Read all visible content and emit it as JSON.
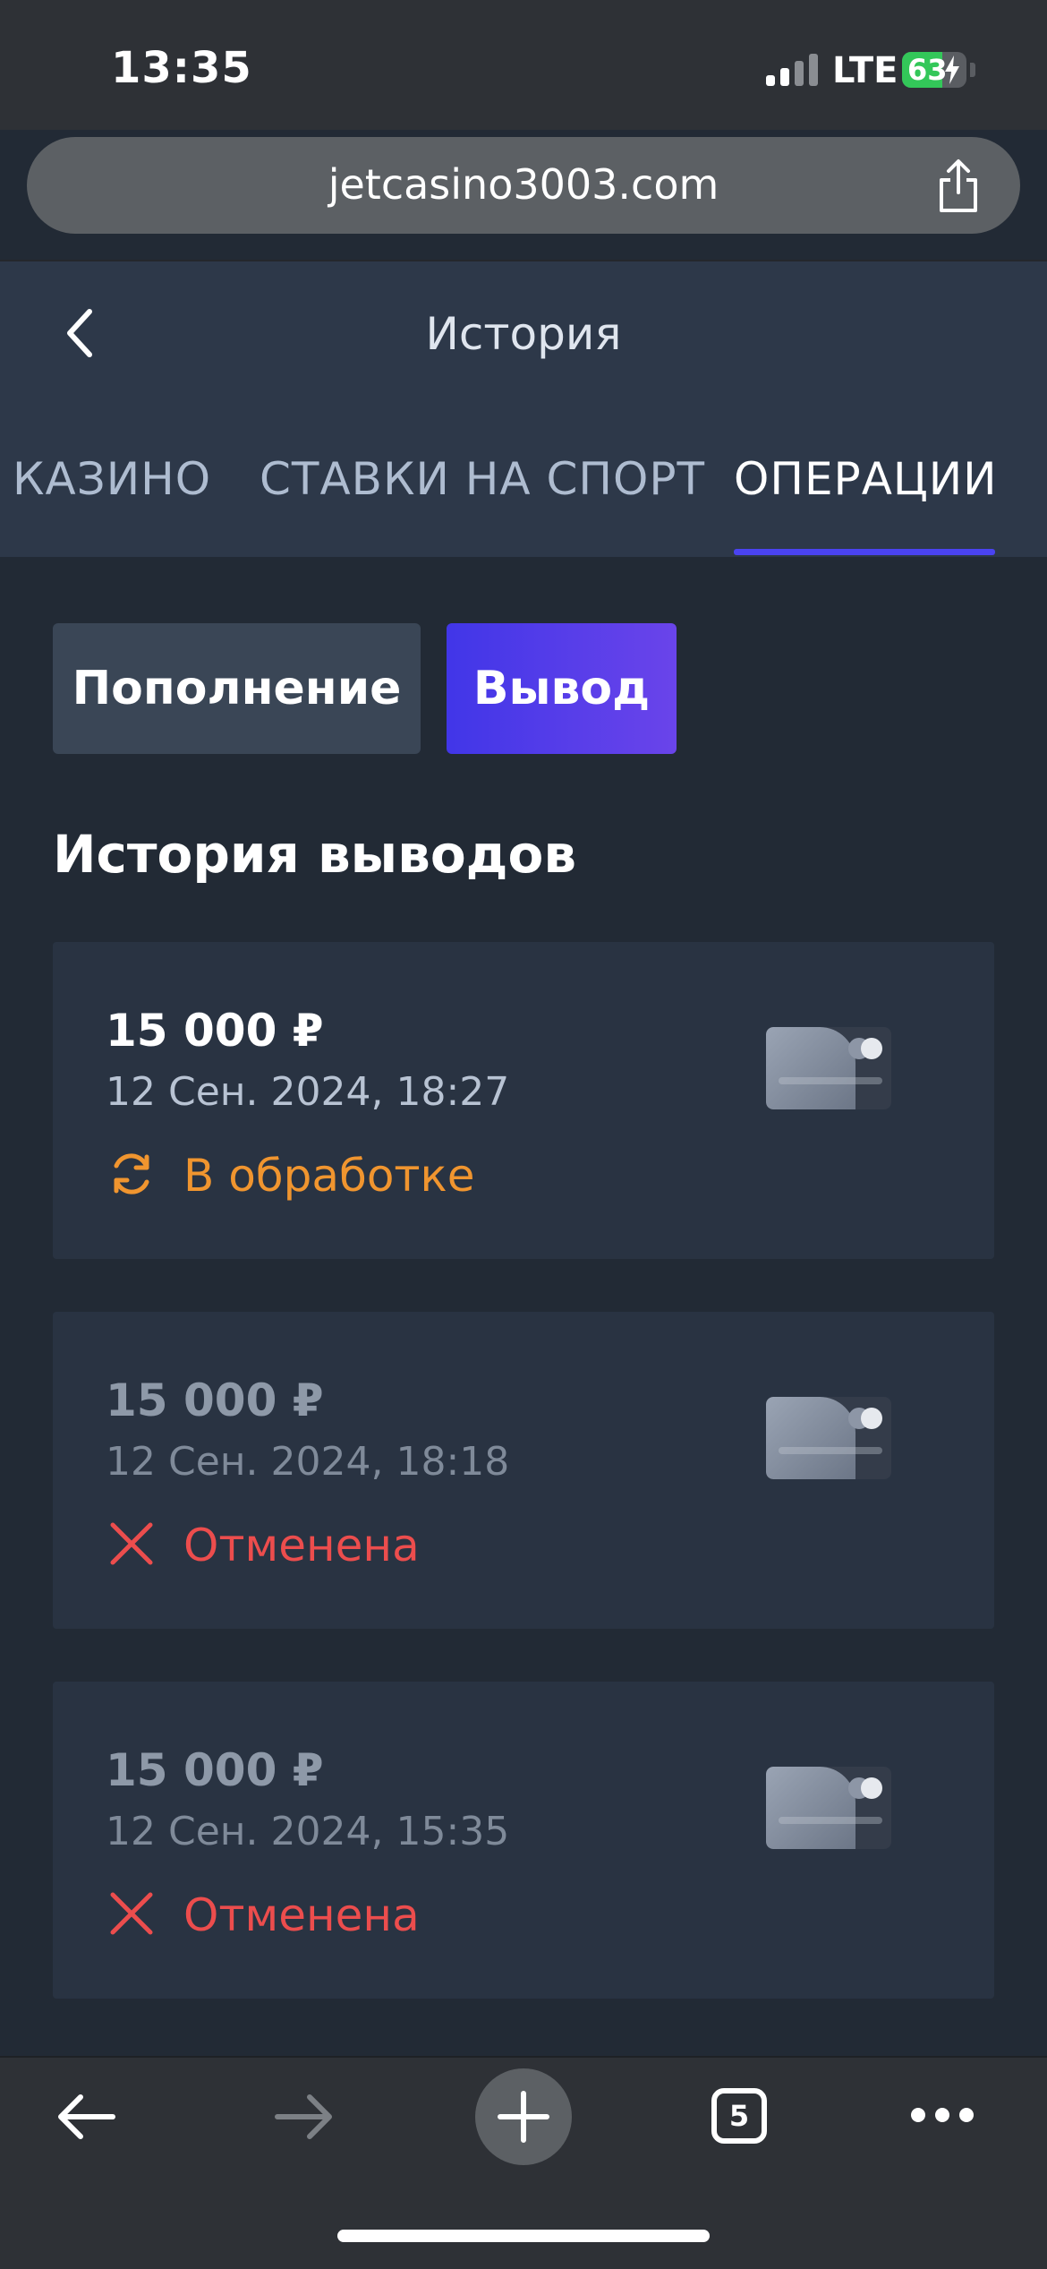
{
  "status_bar": {
    "time": "13:35",
    "network": "LTE",
    "battery_level": "63",
    "battery_fraction": 0.63
  },
  "browser": {
    "url": "jetcasino3003.com",
    "open_tabs": "5",
    "icons": [
      "share-icon",
      "back-arrow-icon",
      "forward-arrow-icon",
      "plus-icon",
      "tabs-icon",
      "more-icon"
    ]
  },
  "header": {
    "title": "История",
    "tabs": [
      {
        "label": "КАЗИНО",
        "active": false
      },
      {
        "label": "СТАВКИ НА СПОРТ",
        "active": false
      },
      {
        "label": "ОПЕРАЦИИ",
        "active": true
      }
    ]
  },
  "segments": {
    "deposit_label": "Пополнение",
    "withdraw_label": "Вывод",
    "selected": "Вывод"
  },
  "section_title": "История выводов",
  "withdrawals": [
    {
      "amount": "15 000 ₽",
      "date": "12 Сен. 2024, 18:27",
      "status": "В обработке",
      "status_type": "pending"
    },
    {
      "amount": "15 000 ₽",
      "date": "12 Сен. 2024, 18:18",
      "status": "Отменена",
      "status_type": "cancelled"
    },
    {
      "amount": "15 000 ₽",
      "date": "12 Сен. 2024, 15:35",
      "status": "Отменена",
      "status_type": "cancelled"
    }
  ],
  "colors": {
    "accent": "#4a43f0",
    "pending": "#f0952f",
    "cancelled": "#ec4d4d",
    "background": "#222a35"
  }
}
